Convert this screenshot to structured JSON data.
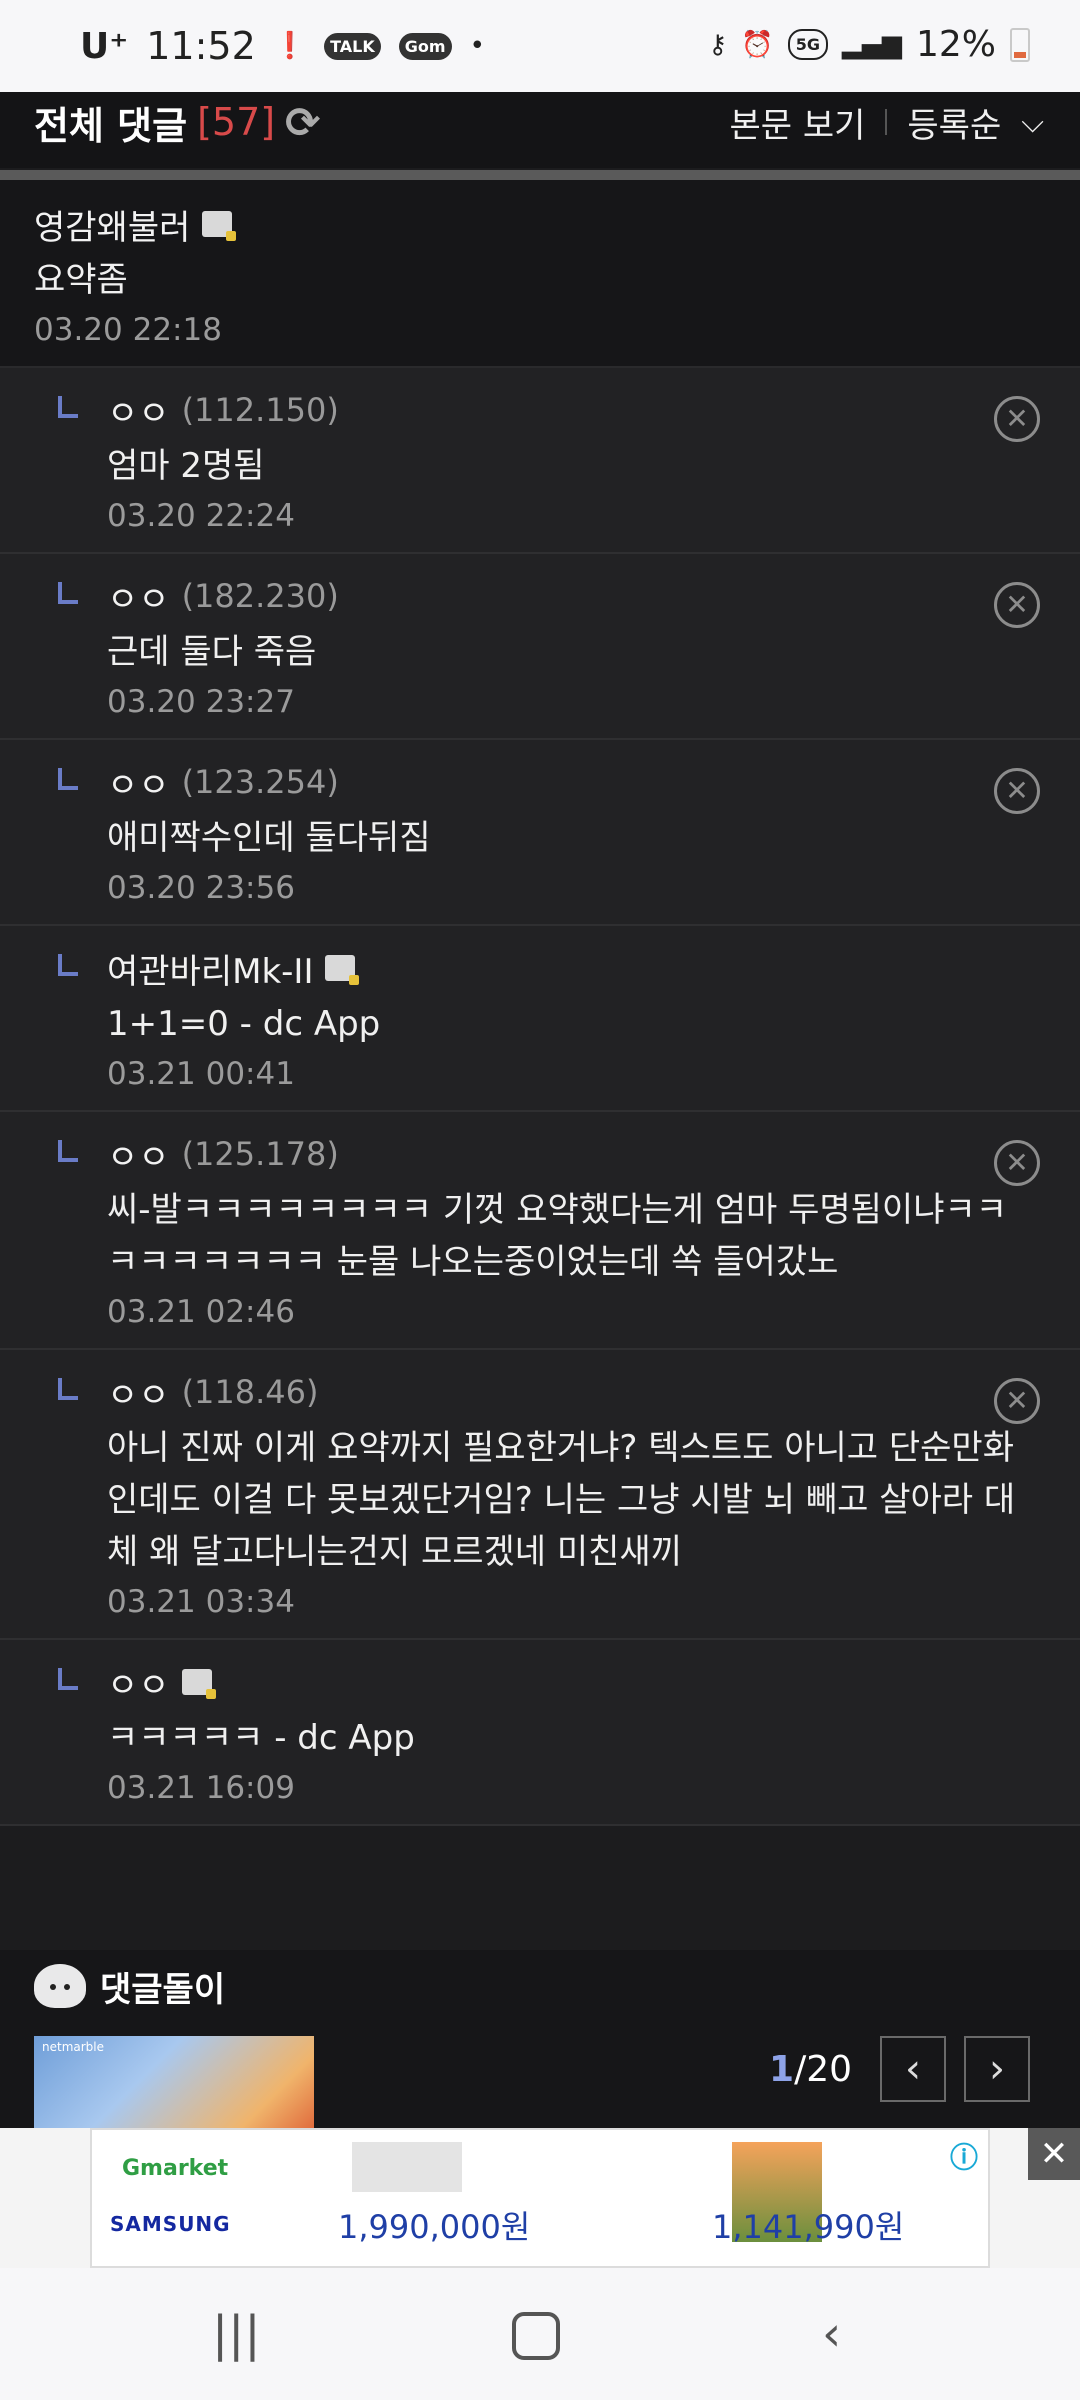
{
  "status_bar": {
    "carrier": "U⁺",
    "time": "11:52",
    "notif_icons": [
      "alert-icon",
      "talk-icon",
      "gom-icon",
      "dot"
    ],
    "talk_label": "TALK",
    "gom_label": "Gom",
    "network": "5G",
    "battery": "12%"
  },
  "header": {
    "title": "전체 댓글",
    "count": "[57]",
    "view_article": "본문 보기",
    "sort": "등록순"
  },
  "comments": [
    {
      "type": "top",
      "nick": "영감왜불러",
      "ip": "",
      "gallog": true,
      "text": "요약좀",
      "date": "03.20 22:18",
      "deletable": false
    },
    {
      "type": "reply",
      "nick": "ㅇㅇ",
      "ip": "(112.150)",
      "gallog": false,
      "text": "엄마 2명됨",
      "date": "03.20 22:24",
      "deletable": true
    },
    {
      "type": "reply",
      "nick": "ㅇㅇ",
      "ip": "(182.230)",
      "gallog": false,
      "text": "근데 둘다 죽음",
      "date": "03.20 23:27",
      "deletable": true
    },
    {
      "type": "reply",
      "nick": "ㅇㅇ",
      "ip": "(123.254)",
      "gallog": false,
      "text": "애미짝수인데 둘다뒤짐",
      "date": "03.20 23:56",
      "deletable": true
    },
    {
      "type": "reply",
      "nick": "여관바리Mk-II",
      "ip": "",
      "gallog": true,
      "text": "1+1=0 - dc App",
      "date": "03.21 00:41",
      "deletable": false
    },
    {
      "type": "reply",
      "nick": "ㅇㅇ",
      "ip": "(125.178)",
      "gallog": false,
      "text": "씨-발ㅋㅋㅋㅋㅋㅋㅋㅋ 기껏 요약했다는게 엄마 두명됨이냐ㅋㅋㅋㅋㅋㅋㅋㅋㅋ 눈물 나오는중이었는데 쏙 들어갔노",
      "date": "03.21 02:46",
      "deletable": true
    },
    {
      "type": "reply",
      "nick": "ㅇㅇ",
      "ip": "(118.46)",
      "gallog": false,
      "text": "아니 진짜 이게 요약까지 필요한거냐? 텍스트도 아니고 단순만화인데도 이걸 다 못보겠단거임? 니는 그냥 시발 뇌 빼고 살아라 대체 왜 달고다니는건지 모르겠네 미친새끼",
      "date": "03.21 03:34",
      "deletable": true
    },
    {
      "type": "reply",
      "nick": "ㅇㅇ",
      "ip": "",
      "gallog": true,
      "text": "ㅋㅋㅋㅋㅋ - dc App",
      "date": "03.21 16:09",
      "deletable": false
    }
  ],
  "reply_bot": {
    "title": "댓글돌이",
    "thumb_label": "netmarble",
    "page_current": "1",
    "page_total": "/20"
  },
  "ad": {
    "brand1": "Gmarket",
    "brand2": "SAMSUNG",
    "price1": "1,990,000원",
    "price2": "1,141,990원"
  },
  "nav": {
    "recent_icon": "|||",
    "back_icon": "‹"
  }
}
